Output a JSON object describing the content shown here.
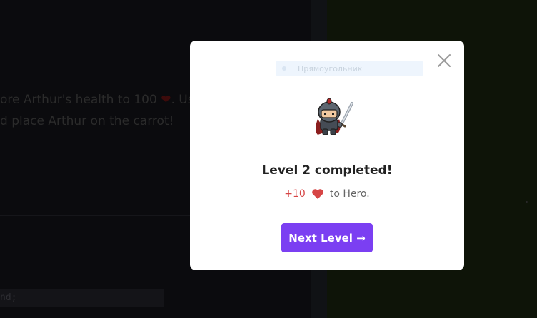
{
  "background": {
    "task_line_1": "ore Arthur's health to 100",
    "task_line_1_suffix": ". Us",
    "task_line_2": "d place Arthur on the carrot!",
    "code_snippet": "nd;"
  },
  "modal": {
    "ghost_input_text": "Прямоугольник",
    "title": "Level 2 completed!",
    "reward_amount": "+10",
    "reward_target": "to Hero.",
    "next_button_label": "Next Level →",
    "accent_color": "#7b3ff2",
    "heart_color": "#d64545",
    "hero_icon": "knight-icon",
    "close_icon": "close-icon"
  }
}
